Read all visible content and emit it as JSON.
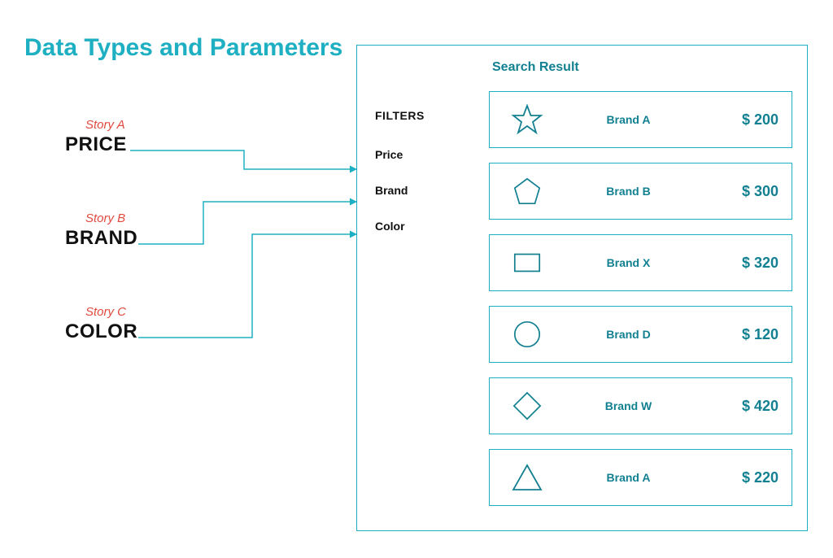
{
  "title": "Data Types and Parameters",
  "stories": {
    "a": {
      "label": "Story A",
      "name": "PRICE"
    },
    "b": {
      "label": "Story B",
      "name": "BRAND"
    },
    "c": {
      "label": "Story C",
      "name": "COLOR"
    }
  },
  "filters": {
    "heading": "FILTERS",
    "items": [
      "Price",
      "Brand",
      "Color"
    ]
  },
  "results": {
    "heading": "Search Result",
    "rows": [
      {
        "icon": "star",
        "brand": "Brand A",
        "price": "$ 200"
      },
      {
        "icon": "pentagon",
        "brand": "Brand B",
        "price": "$ 300"
      },
      {
        "icon": "rect",
        "brand": "Brand X",
        "price": "$ 320"
      },
      {
        "icon": "circle",
        "brand": "Brand D",
        "price": "$ 120"
      },
      {
        "icon": "diamond",
        "brand": "Brand W",
        "price": "$ 420"
      },
      {
        "icon": "triangle",
        "brand": "Brand A",
        "price": "$ 220"
      }
    ]
  },
  "colors": {
    "teal": "#1eb0c2",
    "tealDark": "#128091"
  }
}
